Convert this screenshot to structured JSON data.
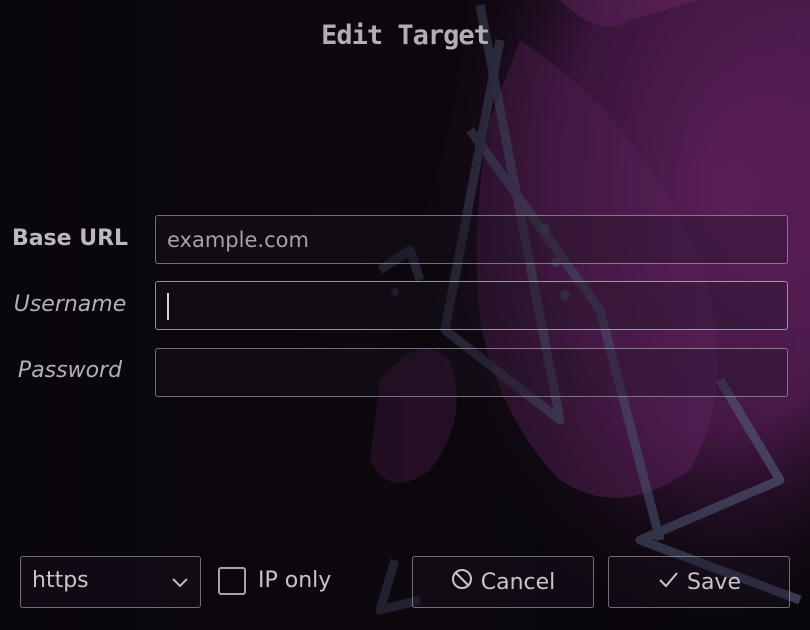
{
  "window": {
    "title": "Edit Target"
  },
  "form": {
    "base_url": {
      "label": "Base URL",
      "placeholder": "example.com",
      "value": ""
    },
    "username": {
      "label": "Username",
      "value": ""
    },
    "password": {
      "label": "Password",
      "value": ""
    }
  },
  "footer": {
    "scheme_select": {
      "selected": "https"
    },
    "ip_only": {
      "label": "IP only",
      "checked": false
    },
    "cancel": {
      "label": "Cancel",
      "icon": "cancel-icon"
    },
    "save": {
      "label": "Save",
      "icon": "checkmark-icon"
    }
  },
  "colors": {
    "background": "#0d0910",
    "accent_art": "#8a2f86"
  }
}
